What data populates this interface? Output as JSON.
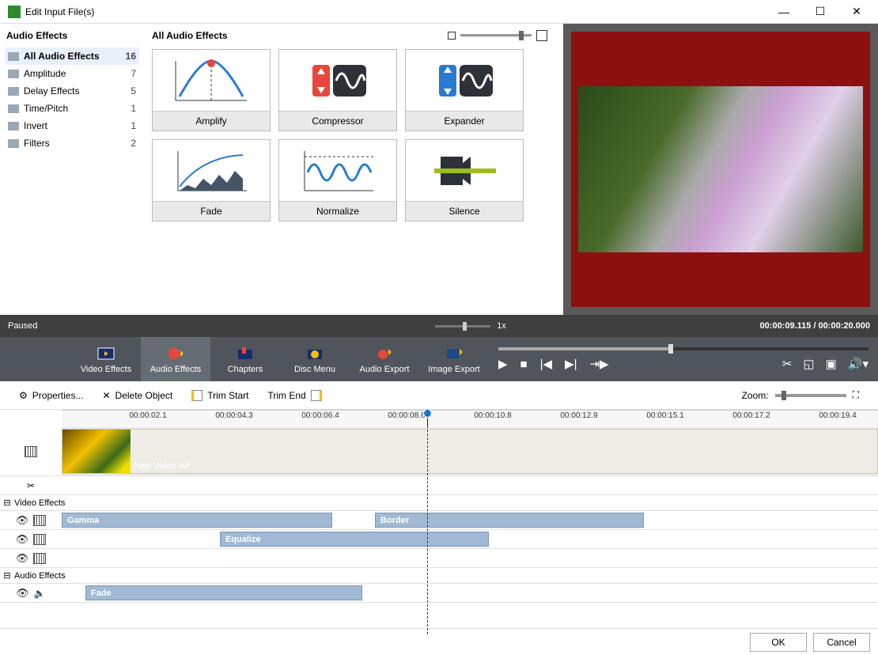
{
  "window": {
    "title": "Edit Input File(s)"
  },
  "sidebar": {
    "heading": "Audio Effects",
    "items": [
      {
        "label": "All Audio Effects",
        "count": "16",
        "selected": true
      },
      {
        "label": "Amplitude",
        "count": "7"
      },
      {
        "label": "Delay Effects",
        "count": "5"
      },
      {
        "label": "Time/Pitch",
        "count": "1"
      },
      {
        "label": "Invert",
        "count": "1"
      },
      {
        "label": "Filters",
        "count": "2"
      }
    ]
  },
  "main": {
    "heading": "All Audio Effects",
    "effects": [
      {
        "name": "Amplify"
      },
      {
        "name": "Compressor"
      },
      {
        "name": "Expander"
      },
      {
        "name": "Fade"
      },
      {
        "name": "Normalize"
      },
      {
        "name": "Silence"
      }
    ]
  },
  "playback": {
    "status": "Paused",
    "speed": "1x",
    "time": "00:00:09.115 / 00:00:20.000"
  },
  "tabs": [
    {
      "label": "Video Effects"
    },
    {
      "label": "Audio Effects",
      "selected": true
    },
    {
      "label": "Chapters"
    },
    {
      "label": "Disc Menu"
    },
    {
      "label": "Audio Export"
    },
    {
      "label": "Image Export"
    }
  ],
  "toolbar": {
    "properties": "Properties...",
    "deleteObject": "Delete Object",
    "trimStart": "Trim Start",
    "trimEnd": "Trim End",
    "zoomLabel": "Zoom:"
  },
  "ruler": [
    "00:00:02.1",
    "00:00:04.3",
    "00:00:06.4",
    "00:00:08.6",
    "00:00:10.8",
    "00:00:12.9",
    "00:00:15.1",
    "00:00:17.2",
    "00:00:19.4"
  ],
  "timeline": {
    "videoFile": "New Video.avi",
    "groups": [
      {
        "label": "Video Effects"
      },
      {
        "label": "Audio Effects"
      }
    ],
    "clips": {
      "gamma": "Gamma",
      "border": "Border",
      "equalize": "Equalize",
      "fade": "Fade"
    }
  },
  "buttons": {
    "ok": "OK",
    "cancel": "Cancel"
  }
}
